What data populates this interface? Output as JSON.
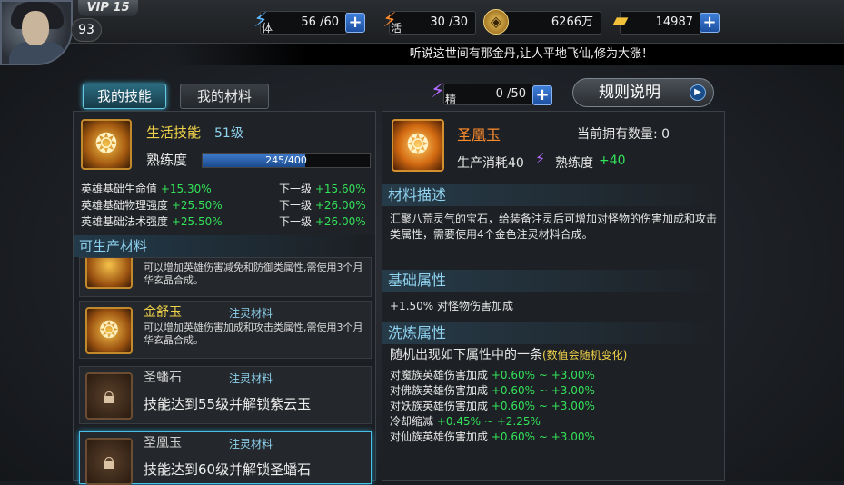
{
  "player": {
    "vip": "VIP 15",
    "level": "93"
  },
  "resources": [
    {
      "icon": "stamina-icon",
      "label": "体",
      "value": "56 /60"
    },
    {
      "icon": "vitality-icon",
      "label": "活",
      "value": "30 /30"
    },
    {
      "icon": "coin-icon",
      "value": "6266万"
    },
    {
      "icon": "gold-ingot-icon",
      "value": "14987"
    }
  ],
  "marquee": "听说这世间有那金丹,让人平地飞仙,修为大涨！",
  "tabs": {
    "skill": "我的技能",
    "material": "我的材料"
  },
  "jing": {
    "label": "精",
    "value": "0 /50"
  },
  "rules_button": "规则说明",
  "skill": {
    "name": "生活技能",
    "level": "51级",
    "proficiency_label": "熟练度",
    "progress_text": "245/400",
    "progress": 0.6125,
    "bonuses": [
      {
        "label": "英雄基础生命值",
        "value": "+15.30%",
        "next_label": "下一级",
        "next_value": "+15.60%"
      },
      {
        "label": "英雄基础物理强度",
        "value": "+25.50%",
        "next_label": "下一级",
        "next_value": "+26.00%"
      },
      {
        "label": "英雄基础法术强度",
        "value": "+25.50%",
        "next_label": "下一级",
        "next_value": "+26.00%"
      }
    ]
  },
  "producible_header": "可生产材料",
  "items": [
    {
      "desc": "可以增加英雄伤害减免和防御类属性,需使用3个月华玄晶合成。"
    },
    {
      "name": "金舒玉",
      "type": "注灵材料",
      "desc": "可以增加英雄伤害加成和攻击类属性,需使用3个月华玄晶合成。"
    },
    {
      "name": "圣蟠石",
      "type": "注灵材料",
      "lock": "技能达到55级并解锁紫云玉"
    },
    {
      "name": "圣凰玉",
      "type": "注灵材料",
      "lock": "技能达到60级并解锁圣蟠石"
    }
  ],
  "detail": {
    "name": "圣凰玉",
    "owned": "当前拥有数量: 0",
    "cost_label": "生产消耗40",
    "prof_label": "熟练度",
    "prof_value": "+40",
    "desc_header": "材料描述",
    "desc": "汇聚八荒灵气的宝石，给装备注灵后可增加对怪物的伤害加成和攻击类属性，需要使用4个金色注灵材料合成。",
    "base_header": "基础属性",
    "base": "+1.50% 对怪物伤害加成",
    "refine_header": "洗炼属性",
    "refine_intro": "随机出现如下属性中的一条",
    "refine_note": "(数值会随机变化)",
    "refine": [
      {
        "label": "对魔族英雄伤害加成",
        "min": "+0.60%",
        "sep": "~",
        "max": "+3.00%"
      },
      {
        "label": "对佛族英雄伤害加成",
        "min": "+0.60%",
        "sep": "~",
        "max": "+3.00%"
      },
      {
        "label": "对妖族英雄伤害加成",
        "min": "+0.60%",
        "sep": "~",
        "max": "+3.00%"
      },
      {
        "label": "冷却缩减",
        "min": "+0.45%",
        "sep": "~",
        "max": "+2.25%"
      },
      {
        "label": "对仙族英雄伤害加成",
        "min": "+0.60%",
        "sep": "~",
        "max": "+3.00%"
      }
    ]
  }
}
